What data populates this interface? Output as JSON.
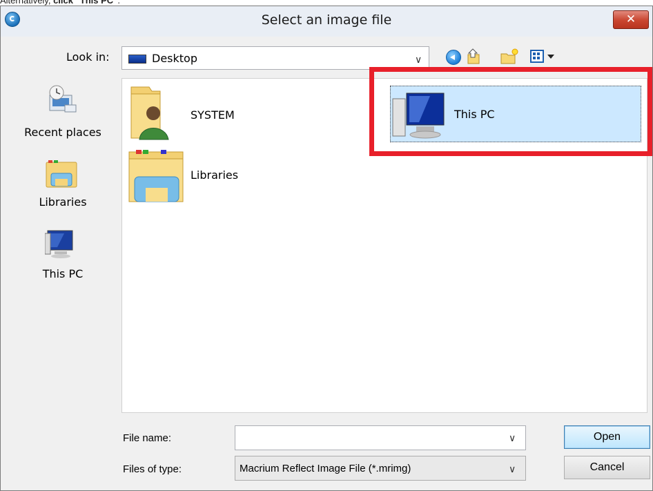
{
  "caption": {
    "prefix": "Alternatively, ",
    "bold": "click \"This PC\"",
    "suffix": "."
  },
  "dialog": {
    "title": "Select an image file",
    "close_label": "✕"
  },
  "lookin": {
    "label": "Look in:",
    "value": "Desktop",
    "arrow": "∨"
  },
  "places": [
    {
      "label": "Recent places"
    },
    {
      "label": "Libraries"
    },
    {
      "label": "This PC"
    }
  ],
  "files": [
    {
      "label": "SYSTEM"
    },
    {
      "label": "Libraries"
    },
    {
      "label": "This PC"
    }
  ],
  "filename": {
    "label": "File name:",
    "value": "",
    "arrow": "∨"
  },
  "filetype": {
    "label": "Files of type:",
    "value": "Macrium Reflect Image File (*.mrimg)",
    "arrow": "∨"
  },
  "buttons": {
    "open": "Open",
    "cancel": "Cancel"
  },
  "colors": {
    "highlight": "#e8202a",
    "selection": "#cce8ff"
  }
}
